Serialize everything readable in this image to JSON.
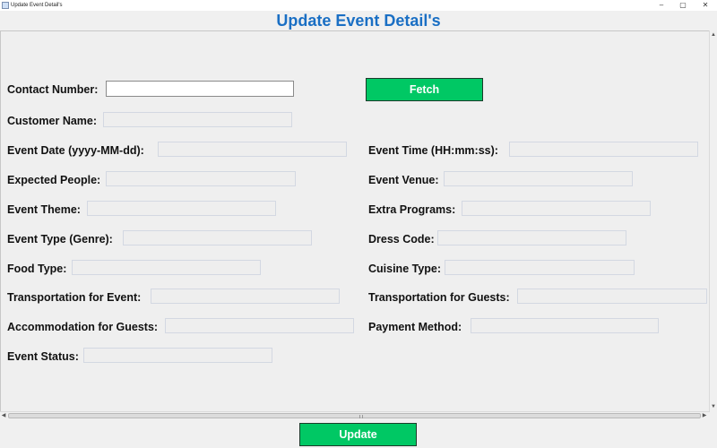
{
  "window": {
    "title": "Update Event Detail's",
    "minimize": "–",
    "maximize": "▢",
    "close": "✕"
  },
  "heading": "Update Event Detail's",
  "fields": {
    "contact_number": {
      "label": "Contact Number:",
      "value": ""
    },
    "customer_name": {
      "label": "Customer Name:",
      "value": ""
    },
    "event_date": {
      "label": "Event Date (yyyy-MM-dd):",
      "value": ""
    },
    "event_time": {
      "label": "Event Time (HH:mm:ss):",
      "value": ""
    },
    "expected_people": {
      "label": "Expected People:",
      "value": ""
    },
    "event_venue": {
      "label": "Event Venue:",
      "value": ""
    },
    "event_theme": {
      "label": "Event Theme:",
      "value": ""
    },
    "extra_programs": {
      "label": "Extra Programs:",
      "value": ""
    },
    "event_type": {
      "label": "Event Type (Genre):",
      "value": ""
    },
    "dress_code": {
      "label": "Dress Code:",
      "value": ""
    },
    "food_type": {
      "label": "Food Type:",
      "value": ""
    },
    "cuisine_type": {
      "label": "Cuisine Type:",
      "value": ""
    },
    "transportation_event": {
      "label": "Transportation for Event:",
      "value": ""
    },
    "transportation_guests": {
      "label": "Transportation for Guests:",
      "value": ""
    },
    "accommodation_guests": {
      "label": "Accommodation for Guests:",
      "value": ""
    },
    "payment_method": {
      "label": "Payment Method:",
      "value": ""
    },
    "event_status": {
      "label": "Event Status:",
      "value": ""
    }
  },
  "buttons": {
    "fetch": "Fetch",
    "update": "Update"
  },
  "colors": {
    "heading": "#1a6fc4",
    "button_bg": "#00c864"
  }
}
